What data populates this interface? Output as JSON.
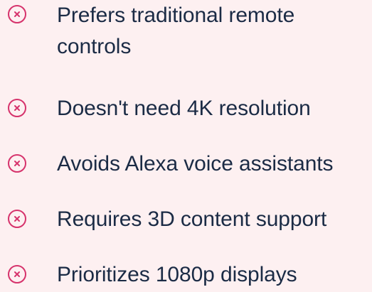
{
  "accent_color": "#d6336c",
  "text_color": "#1b2b45",
  "background_color": "#fdf0f1",
  "items": [
    {
      "icon": "x-circle-icon",
      "label": "Prefers traditional remote controls"
    },
    {
      "icon": "x-circle-icon",
      "label": "Doesn't need 4K resolution"
    },
    {
      "icon": "x-circle-icon",
      "label": "Avoids Alexa voice assistants"
    },
    {
      "icon": "x-circle-icon",
      "label": "Requires 3D content support"
    },
    {
      "icon": "x-circle-icon",
      "label": "Prioritizes 1080p displays"
    }
  ]
}
